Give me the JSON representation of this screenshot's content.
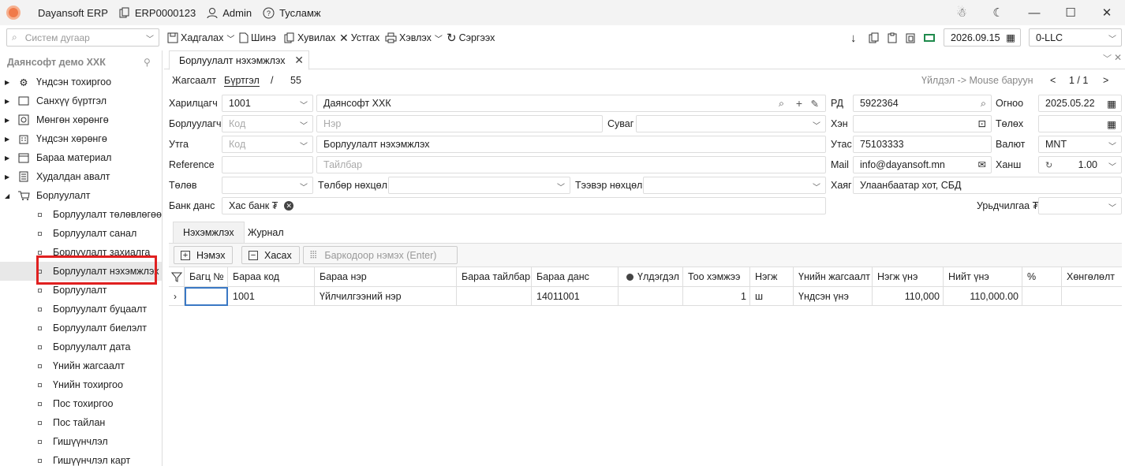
{
  "titlebar": {
    "app_name": "Dayansoft ERP",
    "erp_code": "ERP0000123",
    "user": "Admin",
    "help": "Тусламж"
  },
  "toolbar": {
    "search_placeholder": "Систем дугаар",
    "save": "Хадгалах",
    "new": "Шинэ",
    "copy": "Хувилах",
    "delete": "Устгах",
    "print": "Хэвлэх",
    "refresh": "Сэргээх",
    "date": "2026.09.15",
    "company": "0-LLC"
  },
  "sidebar": {
    "title": "Даянсофт демо ХХК",
    "items": [
      {
        "label": "Үндсэн тохиргоо"
      },
      {
        "label": "Санхүү бүртгэл"
      },
      {
        "label": "Мөнгөн хөрөнгө"
      },
      {
        "label": "Үндсэн хөрөнгө"
      },
      {
        "label": "Бараа материал"
      },
      {
        "label": "Худалдан авалт"
      },
      {
        "label": "Борлуулалт"
      }
    ],
    "sub_items": [
      {
        "label": "Борлуулалт төлөвлөгөө"
      },
      {
        "label": "Борлуулалт санал"
      },
      {
        "label": "Борлуулалт захиалга"
      },
      {
        "label": "Борлуулалт нэхэмжлэх"
      },
      {
        "label": "Борлуулалт"
      },
      {
        "label": "Борлуулалт буцаалт"
      },
      {
        "label": "Борлуулалт биелэлт"
      },
      {
        "label": "Борлуулалт дата"
      },
      {
        "label": "Үнийн жагсаалт"
      },
      {
        "label": "Үнийн тохиргоо"
      },
      {
        "label": "Пос тохиргоо"
      },
      {
        "label": "Пос тайлан"
      },
      {
        "label": "Гишүүнчлэл"
      },
      {
        "label": "Гишүүнчлэл карт"
      }
    ]
  },
  "doc_tab": {
    "title": "Борлуулалт нэхэмжлэх"
  },
  "breadcrumb": {
    "list": "Жагсаалт",
    "register": "Бүртгэл",
    "sep": "/",
    "count": "55"
  },
  "nav": {
    "hint": "Үйлдэл -> Mouse баруун",
    "prev": "<",
    "page": "1 / 1",
    "next": ">"
  },
  "form": {
    "customer_label": "Харилцагч",
    "customer_code": "1001",
    "customer_name": "Даянсофт ХХК",
    "seller_label": "Борлуулагч",
    "seller_code_ph": "Код",
    "seller_name_ph": "Нэр",
    "channel_label": "Суваг",
    "route_label": "Утга",
    "route_code_ph": "Код",
    "route_value": "Борлуулалт нэхэмжлэх",
    "reference_label": "Reference",
    "note_ph": "Тайлбар",
    "payment_label": "Төлөв",
    "payment_terms_label": "Төлбөр нөхцөл",
    "transport_label": "Тээвэр нөхцөл",
    "bank_label": "Банк данс",
    "bank_value": "Хас банк ₮",
    "rd_label": "РД",
    "rd_value": "5922364",
    "who_label": "Хэн",
    "phone_label": "Утас",
    "phone_value": "75103333",
    "mail_label": "Mail",
    "mail_value": "info@dayansoft.mn",
    "address_label": "Хаяг",
    "address_value": "Улаанбаатар хот, СБД",
    "date_label": "Огноо",
    "date_value": "2025.05.22",
    "pay_date_label": "Төлөх",
    "currency_label": "Валют",
    "currency_value": "MNT",
    "rate_label": "Ханш",
    "rate_value": "1.00",
    "prepay_label": "Урьдчилгаа ₮"
  },
  "grid_tabs": {
    "invoice": "Нэхэмжлэх",
    "journal": "Журнал"
  },
  "grid_actions": {
    "add": "Нэмэх",
    "remove": "Хасах",
    "barcode_ph": "Баркодоор нэмэх (Enter)"
  },
  "grid": {
    "columns": [
      "Багц №",
      "Бараа код",
      "Бараа нэр",
      "Бараа тайлбар",
      "Бараа данс",
      "Үлдэгдэл",
      "Тоо хэмжээ",
      "Нэгж",
      "Үнийн жагсаалт",
      "Нэгж үнэ",
      "Нийт үнэ",
      "%",
      "Хөнгөлөлт"
    ],
    "rows": [
      {
        "batch": "",
        "code": "1001",
        "name": "Үйлчилгээний нэр",
        "desc": "",
        "account": "14011001",
        "stock": "",
        "qty": "1",
        "unit": "ш",
        "pricelist": "Үндсэн үнэ",
        "unit_price": "110,000",
        "total": "110,000.00",
        "pct": "",
        "discount": ""
      }
    ]
  }
}
